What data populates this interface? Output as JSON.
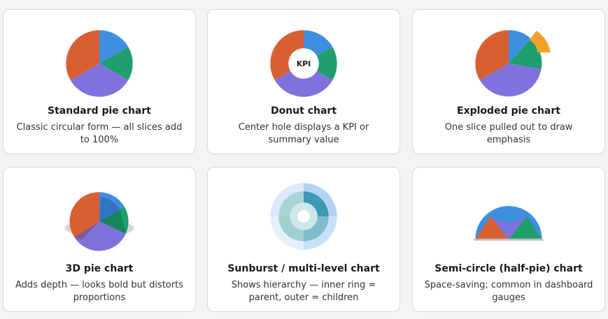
{
  "colors": {
    "blue": "#3f8fe0",
    "green": "#1f9e6e",
    "purple": "#7f72dc",
    "orange": "#d95f33",
    "gold": "#f0a12a",
    "gray": "#d6d6d6"
  },
  "cards": [
    {
      "title": "Standard pie chart",
      "desc": "Classic circular form — all slices add to 100%"
    },
    {
      "title": "Donut chart",
      "desc": "Center hole displays a KPI or summary value",
      "center_label": "KPI"
    },
    {
      "title": "Exploded pie chart",
      "desc": "One slice pulled out to draw emphasis"
    },
    {
      "title": "3D pie chart",
      "desc": "Adds depth — looks bold but distorts proportions"
    },
    {
      "title": "Sunburst / multi-level chart",
      "desc": "Shows hierarchy — inner ring = parent, outer = children"
    },
    {
      "title": "Semi-circle (half-pie) chart",
      "desc": "Space-saving; common in dashboard gauges"
    }
  ]
}
